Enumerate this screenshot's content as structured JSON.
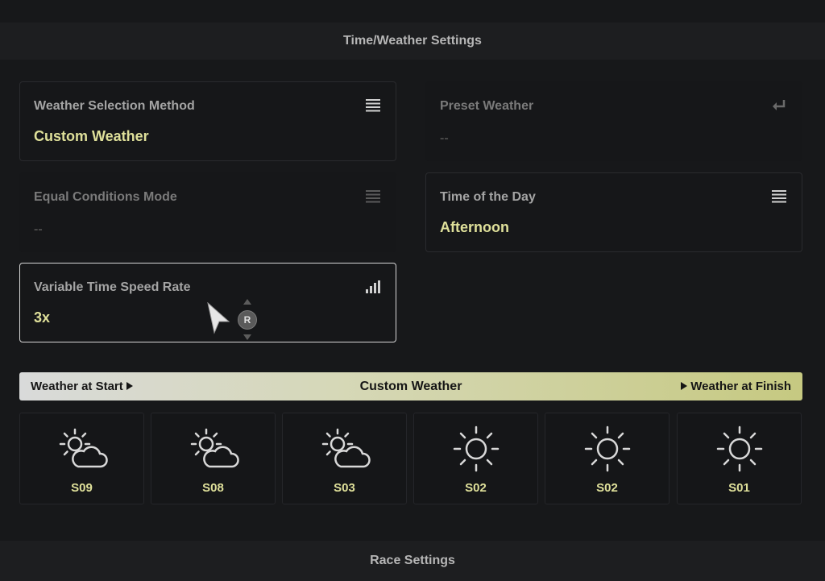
{
  "header": {
    "title": "Time/Weather Settings"
  },
  "footer": {
    "title": "Race Settings"
  },
  "settings": {
    "weather_selection": {
      "label": "Weather Selection Method",
      "value": "Custom Weather",
      "icon": "list-icon"
    },
    "preset_weather": {
      "label": "Preset Weather",
      "value": "--",
      "icon": "enter-icon"
    },
    "equal_conditions": {
      "label": "Equal Conditions Mode",
      "value": "--",
      "icon": "list-icon"
    },
    "time_of_day": {
      "label": "Time of the Day",
      "value": "Afternoon",
      "icon": "list-icon"
    },
    "time_speed": {
      "label": "Variable Time Speed Rate",
      "value": "3x",
      "icon": "signal-bars-icon"
    }
  },
  "cursor": {
    "button_label": "R"
  },
  "weather_bar": {
    "start": "Weather at Start",
    "middle": "Custom Weather",
    "finish": "Weather at Finish"
  },
  "weather_slots": [
    {
      "code": "S09",
      "icon": "partly-cloudy-icon"
    },
    {
      "code": "S08",
      "icon": "partly-cloudy-icon"
    },
    {
      "code": "S03",
      "icon": "partly-cloudy-icon"
    },
    {
      "code": "S02",
      "icon": "sun-icon"
    },
    {
      "code": "S02",
      "icon": "sun-icon"
    },
    {
      "code": "S01",
      "icon": "sun-icon"
    }
  ],
  "colors": {
    "accent": "#dfe09a",
    "background": "#17181a"
  }
}
